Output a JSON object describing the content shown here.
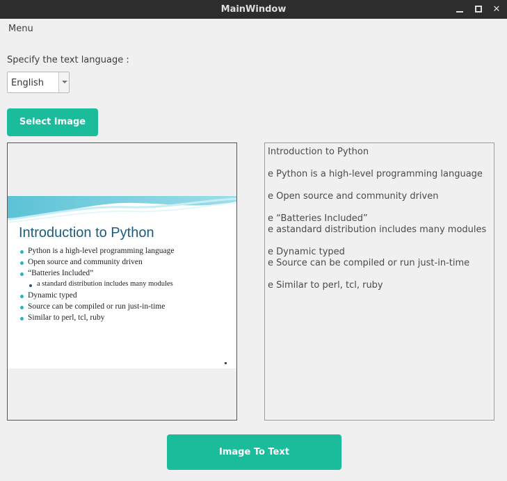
{
  "window": {
    "title": "MainWindow"
  },
  "menubar": {
    "menu_label": "Menu"
  },
  "language": {
    "label": "Specify the text language :",
    "selected": "English"
  },
  "buttons": {
    "select_image": "Select Image",
    "image_to_text": "Image To Text"
  },
  "slide": {
    "title": "Introduction to Python",
    "bullets": [
      {
        "text": "Python is a high-level programming language",
        "level": 1
      },
      {
        "text": "Open source and community driven",
        "level": 1
      },
      {
        "text": "“Batteries Included”",
        "level": 1
      },
      {
        "text": "a standard distribution includes many modules",
        "level": 2
      },
      {
        "text": "Dynamic typed",
        "level": 1
      },
      {
        "text": "Source can be compiled or run just-in-time",
        "level": 1
      },
      {
        "text": "Similar to perl, tcl, ruby",
        "level": 1
      }
    ]
  },
  "output": {
    "lines": [
      "Introduction to Python",
      "",
      "e Python is a high-level programming language",
      "",
      "e Open source and community driven",
      "",
      "e “Batteries Included”",
      "e astandard distribution includes many modules",
      "",
      "e Dynamic typed",
      "e Source can be compiled or run just-in-time",
      "",
      "e Similar to perl, tcl, ruby"
    ]
  },
  "colors": {
    "accent": "#1abc9c",
    "titlebar": "#2d2d2d",
    "slide_title": "#1a5c7a",
    "bullet": "#2ab0c8"
  }
}
